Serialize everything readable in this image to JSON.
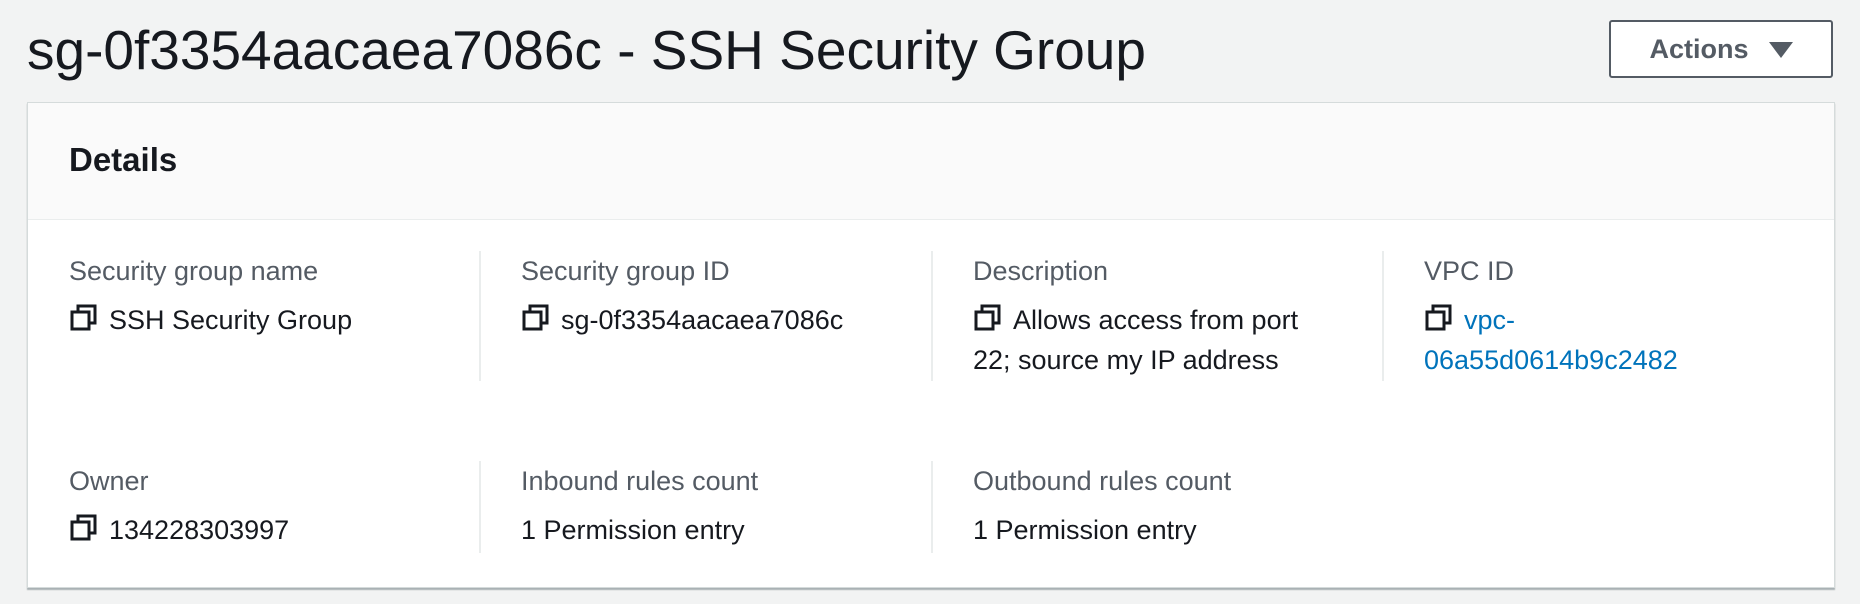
{
  "header": {
    "title": "sg-0f3354aacaea7086c - SSH Security Group",
    "actions_label": "Actions"
  },
  "details": {
    "title": "Details",
    "fields": [
      {
        "label": "Security group name",
        "value": "SSH Security Group",
        "copyable": true
      },
      {
        "label": "Security group ID",
        "value": "sg-0f3354aacaea7086c",
        "copyable": true
      },
      {
        "label": "Description",
        "value": "Allows access from port 22; source my IP address",
        "copyable": true
      },
      {
        "label": "VPC ID",
        "value_line1": "vpc-",
        "value_line2": "06a55d0614b9c2482",
        "copyable": true,
        "link": true
      },
      {
        "label": "Owner",
        "value": "134228303997",
        "copyable": true
      },
      {
        "label": "Inbound rules count",
        "value": "1 Permission entry",
        "copyable": false
      },
      {
        "label": "Outbound rules count",
        "value": "1 Permission entry",
        "copyable": false
      }
    ]
  },
  "icons": {
    "copy": "copy-icon",
    "dropdown": "caret-down-icon"
  },
  "colors": {
    "background": "#f2f3f3",
    "text": "#16191f",
    "label": "#545b64",
    "link": "#0073bb",
    "panel_border": "#d5dbdb"
  }
}
